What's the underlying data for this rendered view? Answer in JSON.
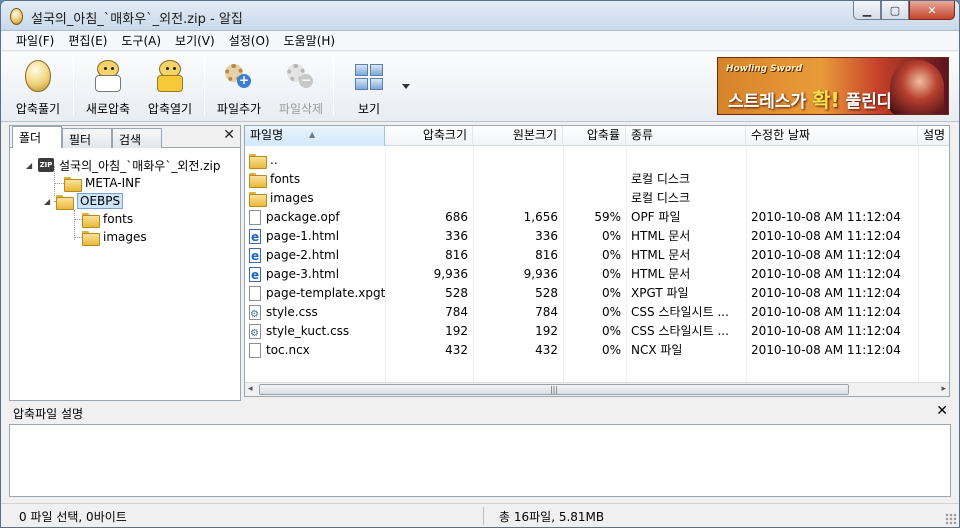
{
  "window": {
    "title": "설국의_아침_`매화우`_외전.zip - 알집",
    "controls": {
      "minimize": "▁",
      "maximize": "▢",
      "close": "✕"
    }
  },
  "menu": [
    "파일(F)",
    "편집(E)",
    "도구(A)",
    "보기(V)",
    "설정(O)",
    "도움말(H)"
  ],
  "toolbar": {
    "extract": "압축풀기",
    "new_archive": "새로압축",
    "open_archive": "압축열기",
    "add_files": "파일추가",
    "delete_files": "파일삭제",
    "view": "보기"
  },
  "banner": {
    "logo": "Howling Sword",
    "slogan_pre": "스트레스가 ",
    "slogan_big": "확!",
    "slogan_post": " 풀린다"
  },
  "left_panel": {
    "tabs": [
      "폴더",
      "필터",
      "검색"
    ],
    "active_tab": 0,
    "close": "✕",
    "tree": [
      {
        "label": "설국의_아침_`매화우`_외전.zip",
        "type": "zip",
        "expander": "◢",
        "depth": 0
      },
      {
        "label": "META-INF",
        "type": "folder",
        "expander": "",
        "depth": 1
      },
      {
        "label": "OEBPS",
        "type": "folder",
        "expander": "◢",
        "depth": 1,
        "selected": true
      },
      {
        "label": "fonts",
        "type": "folder",
        "expander": "",
        "depth": 2
      },
      {
        "label": "images",
        "type": "folder",
        "expander": "",
        "depth": 2
      }
    ]
  },
  "file_list": {
    "columns": [
      "파일명",
      "압축크기",
      "원본크기",
      "압축률",
      "종류",
      "수정한 날짜",
      "설명"
    ],
    "sort_indicator": "▲",
    "rows": [
      {
        "name": "..",
        "type_icon": "folder",
        "compressed": "",
        "original": "",
        "ratio": "",
        "kind": "",
        "modified": ""
      },
      {
        "name": "fonts",
        "type_icon": "folder",
        "compressed": "",
        "original": "",
        "ratio": "",
        "kind": "로컬 디스크",
        "modified": ""
      },
      {
        "name": "images",
        "type_icon": "folder",
        "compressed": "",
        "original": "",
        "ratio": "",
        "kind": "로컬 디스크",
        "modified": ""
      },
      {
        "name": "package.opf",
        "type_icon": "file",
        "compressed": "686",
        "original": "1,656",
        "ratio": "59%",
        "kind": "OPF 파일",
        "modified": "2010-10-08 AM 11:12:04"
      },
      {
        "name": "page-1.html",
        "type_icon": "html",
        "compressed": "336",
        "original": "336",
        "ratio": "0%",
        "kind": "HTML 문서",
        "modified": "2010-10-08 AM 11:12:04"
      },
      {
        "name": "page-2.html",
        "type_icon": "html",
        "compressed": "816",
        "original": "816",
        "ratio": "0%",
        "kind": "HTML 문서",
        "modified": "2010-10-08 AM 11:12:04"
      },
      {
        "name": "page-3.html",
        "type_icon": "html",
        "compressed": "9,936",
        "original": "9,936",
        "ratio": "0%",
        "kind": "HTML 문서",
        "modified": "2010-10-08 AM 11:12:04"
      },
      {
        "name": "page-template.xpgt",
        "type_icon": "file",
        "compressed": "528",
        "original": "528",
        "ratio": "0%",
        "kind": "XPGT 파일",
        "modified": "2010-10-08 AM 11:12:04"
      },
      {
        "name": "style.css",
        "type_icon": "css",
        "compressed": "784",
        "original": "784",
        "ratio": "0%",
        "kind": "CSS 스타일시트 ...",
        "modified": "2010-10-08 AM 11:12:04"
      },
      {
        "name": "style_kuct.css",
        "type_icon": "css",
        "compressed": "192",
        "original": "192",
        "ratio": "0%",
        "kind": "CSS 스타일시트 ...",
        "modified": "2010-10-08 AM 11:12:04"
      },
      {
        "name": "toc.ncx",
        "type_icon": "file",
        "compressed": "432",
        "original": "432",
        "ratio": "0%",
        "kind": "NCX 파일",
        "modified": "2010-10-08 AM 11:12:04"
      }
    ],
    "scroll": {
      "left": "◂",
      "right": "▸",
      "grip": "|||"
    }
  },
  "description_panel": {
    "title": "압축파일 설명",
    "close": "✕"
  },
  "status": {
    "selection": "0 파일 선택,  0바이트",
    "total": "총 16파일,  5.81MB"
  },
  "colors": {
    "selection_bg": "#cce4f7",
    "selection_border": "#7da2ce",
    "titlebar": "#c9d9ea"
  }
}
